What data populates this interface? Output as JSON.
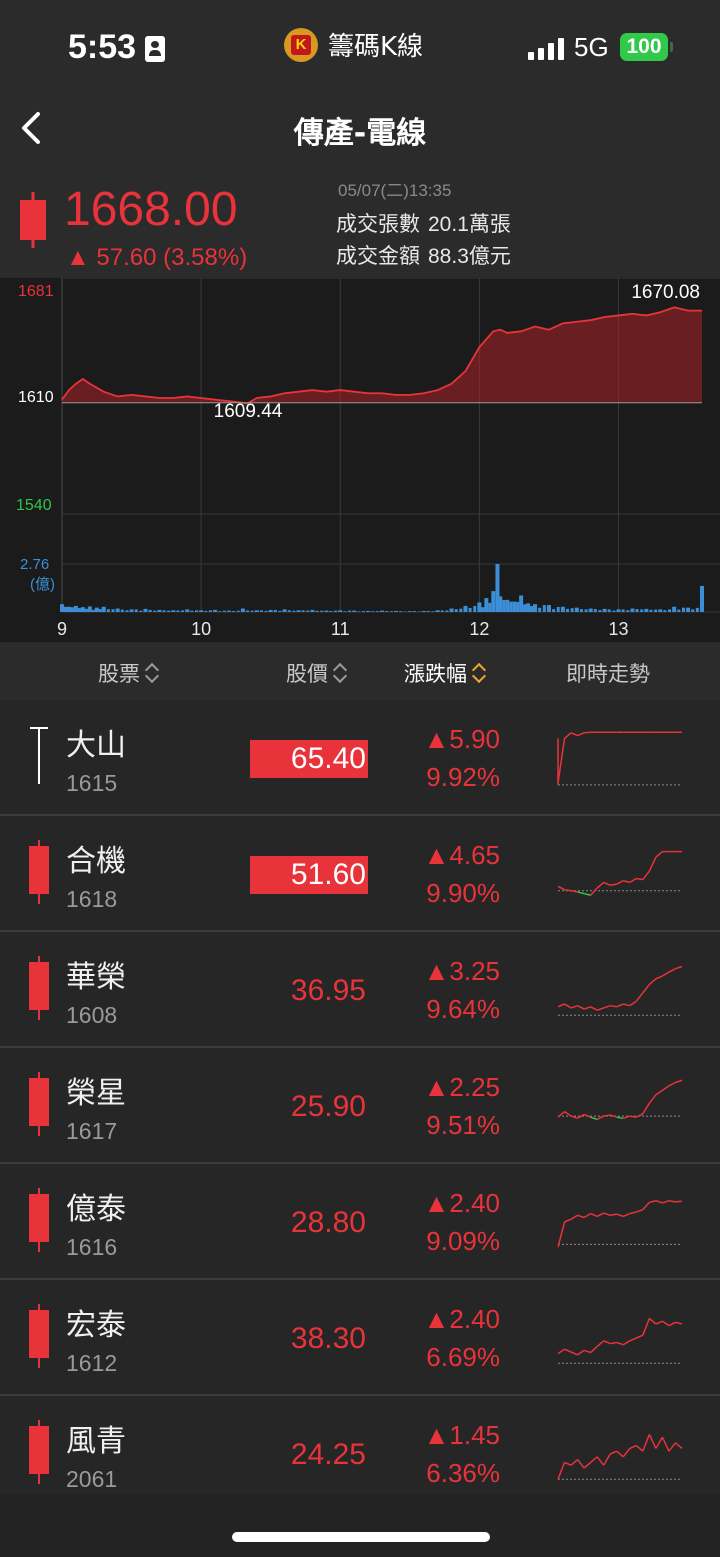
{
  "status_bar": {
    "time": "5:53",
    "app_name": "籌碼K線",
    "app_logo_letter": "K",
    "network": "5G",
    "battery": "100"
  },
  "nav": {
    "title": "傳產-電線",
    "back_icon": "chevron-left-icon"
  },
  "quote": {
    "price": "1668.00",
    "change": "▲ 57.60 (3.58%)",
    "datetime": "05/07(二)13:35",
    "volume_label": "成交張數",
    "volume_value": "20.1萬張",
    "amount_label": "成交金額",
    "amount_value": "88.3億元"
  },
  "chart_data": {
    "type": "area",
    "y_labels": {
      "top": "1681",
      "ref": "1610",
      "bottom": "1540"
    },
    "ylim": [
      1540,
      1681
    ],
    "reference": 1610,
    "high_label": "1670.08",
    "low_label": "1609.44",
    "volume_label_value": "2.76",
    "volume_label_unit": "(億)",
    "x_ticks": [
      "9",
      "10",
      "11",
      "12",
      "13"
    ],
    "x_range": [
      9.0,
      13.6
    ],
    "x": [
      9.0,
      9.05,
      9.1,
      9.15,
      9.2,
      9.3,
      9.4,
      9.5,
      9.6,
      9.7,
      9.8,
      9.9,
      10.0,
      10.1,
      10.2,
      10.3,
      10.33,
      10.4,
      10.5,
      10.6,
      10.7,
      10.8,
      10.9,
      11.0,
      11.1,
      11.2,
      11.3,
      11.4,
      11.5,
      11.6,
      11.7,
      11.8,
      11.9,
      12.0,
      12.05,
      12.1,
      12.15,
      12.2,
      12.3,
      12.4,
      12.5,
      12.6,
      12.7,
      12.8,
      12.9,
      13.0,
      13.1,
      13.2,
      13.3,
      13.4,
      13.5,
      13.6
    ],
    "y": [
      1612,
      1618,
      1622,
      1625,
      1622,
      1617,
      1614,
      1615,
      1614,
      1613,
      1613,
      1614,
      1613,
      1612,
      1611,
      1610,
      1609.44,
      1613,
      1614,
      1616,
      1617,
      1618,
      1617,
      1618,
      1617,
      1616,
      1616,
      1615,
      1615,
      1616,
      1618,
      1622,
      1630,
      1645,
      1650,
      1655,
      1656,
      1654,
      1655,
      1658,
      1656,
      1660,
      1661,
      1662,
      1664,
      1665,
      1666,
      1665,
      1667,
      1670.08,
      1668,
      1668
    ],
    "volume": {
      "unit": "億",
      "max": 2.76,
      "x": [
        9.0,
        9.05,
        9.1,
        9.15,
        9.2,
        9.25,
        9.3,
        9.4,
        9.5,
        9.6,
        9.7,
        9.8,
        9.9,
        10.0,
        10.1,
        10.2,
        10.3,
        10.4,
        10.5,
        10.6,
        10.7,
        10.8,
        10.9,
        11.0,
        11.1,
        11.2,
        11.3,
        11.4,
        11.5,
        11.6,
        11.7,
        11.8,
        11.9,
        12.0,
        12.05,
        12.1,
        12.13,
        12.15,
        12.2,
        12.25,
        12.3,
        12.35,
        12.4,
        12.5,
        12.6,
        12.7,
        12.8,
        12.9,
        13.0,
        13.1,
        13.2,
        13.3,
        13.4,
        13.5,
        13.6
      ],
      "values": [
        0.45,
        0.3,
        0.35,
        0.28,
        0.32,
        0.25,
        0.3,
        0.2,
        0.15,
        0.18,
        0.12,
        0.1,
        0.15,
        0.1,
        0.12,
        0.08,
        0.2,
        0.1,
        0.12,
        0.15,
        0.1,
        0.12,
        0.08,
        0.1,
        0.08,
        0.06,
        0.08,
        0.06,
        0.05,
        0.06,
        0.1,
        0.2,
        0.35,
        0.55,
        0.8,
        1.2,
        2.76,
        0.9,
        0.7,
        0.6,
        0.95,
        0.5,
        0.45,
        0.4,
        0.3,
        0.25,
        0.2,
        0.18,
        0.15,
        0.2,
        0.18,
        0.15,
        0.3,
        0.25,
        1.5
      ]
    }
  },
  "table": {
    "headers": {
      "stock": "股票",
      "price": "股價",
      "change": "漲跌幅",
      "trend": "即時走勢"
    },
    "rows": [
      {
        "name": "大山",
        "code": "1615",
        "price": "65.40",
        "limit_up": true,
        "change": "▲5.90",
        "pct": "9.92%",
        "candle": "doji",
        "spark_ref": 0.02,
        "spark": [
          0.05,
          0.85,
          0.95,
          0.9,
          0.95,
          0.96,
          0.96,
          0.96,
          0.96,
          0.96,
          0.96,
          0.96,
          0.96,
          0.96,
          0.96,
          0.96,
          0.96,
          0.96,
          0.96,
          0.96
        ]
      },
      {
        "name": "合機",
        "code": "1618",
        "price": "51.60",
        "limit_up": true,
        "change": "▲4.65",
        "pct": "9.90%",
        "candle": "red",
        "spark_ref": 0.2,
        "spark": [
          0.28,
          0.22,
          0.2,
          0.18,
          0.15,
          0.12,
          0.25,
          0.35,
          0.3,
          0.32,
          0.38,
          0.35,
          0.42,
          0.4,
          0.55,
          0.8,
          0.9,
          0.9,
          0.9,
          0.9
        ]
      },
      {
        "name": "華榮",
        "code": "1608",
        "price": "36.95",
        "limit_up": false,
        "change": "▲3.25",
        "pct": "9.64%",
        "candle": "red",
        "spark_ref": 0.05,
        "spark": [
          0.2,
          0.25,
          0.18,
          0.22,
          0.16,
          0.2,
          0.14,
          0.18,
          0.22,
          0.2,
          0.25,
          0.22,
          0.3,
          0.45,
          0.6,
          0.7,
          0.75,
          0.82,
          0.88,
          0.92
        ]
      },
      {
        "name": "榮星",
        "code": "1617",
        "price": "25.90",
        "limit_up": false,
        "change": "▲2.25",
        "pct": "9.51%",
        "candle": "red",
        "spark_ref": 0.32,
        "spark": [
          0.3,
          0.4,
          0.32,
          0.28,
          0.35,
          0.3,
          0.26,
          0.32,
          0.34,
          0.3,
          0.28,
          0.32,
          0.3,
          0.36,
          0.55,
          0.7,
          0.78,
          0.86,
          0.92,
          0.96
        ]
      },
      {
        "name": "億泰",
        "code": "1616",
        "price": "28.80",
        "limit_up": false,
        "change": "▲2.40",
        "pct": "9.09%",
        "candle": "red",
        "spark_ref": 0.1,
        "spark": [
          0.05,
          0.5,
          0.55,
          0.62,
          0.58,
          0.65,
          0.6,
          0.66,
          0.62,
          0.64,
          0.6,
          0.65,
          0.68,
          0.72,
          0.85,
          0.88,
          0.84,
          0.88,
          0.86,
          0.87
        ]
      },
      {
        "name": "宏泰",
        "code": "1612",
        "price": "38.30",
        "limit_up": false,
        "change": "▲2.40",
        "pct": "6.69%",
        "candle": "red",
        "spark_ref": 0.05,
        "spark": [
          0.22,
          0.3,
          0.25,
          0.2,
          0.28,
          0.24,
          0.35,
          0.45,
          0.4,
          0.42,
          0.38,
          0.45,
          0.5,
          0.55,
          0.85,
          0.75,
          0.8,
          0.72,
          0.78,
          0.75
        ]
      },
      {
        "name": "風青",
        "code": "2061",
        "price": "24.25",
        "limit_up": false,
        "change": "▲1.45",
        "pct": "6.36%",
        "candle": "red",
        "spark_ref": 0.05,
        "spark": [
          0.05,
          0.35,
          0.3,
          0.4,
          0.25,
          0.35,
          0.45,
          0.3,
          0.5,
          0.55,
          0.45,
          0.6,
          0.65,
          0.55,
          0.85,
          0.6,
          0.8,
          0.55,
          0.7,
          0.6
        ]
      }
    ]
  },
  "colors": {
    "up": "#e8333a",
    "down": "#2fc34a",
    "volume": "#3b8fd6",
    "accent_sort": "#f0a535"
  }
}
